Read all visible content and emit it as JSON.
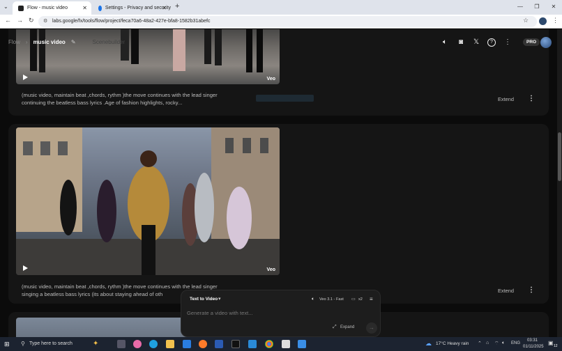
{
  "browser": {
    "tabs": [
      {
        "title": "Flow - music video",
        "icon": "flow-favicon",
        "active": true
      },
      {
        "title": "Settings - Privacy and security",
        "icon": "gear-favicon",
        "active": false
      }
    ],
    "url": "labs.google/fx/tools/flow/project/feca70a6-48a2-427e-bfa8-1582b31abefc"
  },
  "app": {
    "breadcrumb": {
      "root": "Flow",
      "current": "music video",
      "scenebuilder": "Scenebuilder"
    },
    "pro_badge": "PRO",
    "icons": [
      "speaker-icon",
      "discord-icon",
      "x-icon",
      "help-icon",
      "more-vert-icon"
    ]
  },
  "cards": [
    {
      "prompt": "(music video, maintain beat ,chords, rythm )the move continues with the lead singer continuing the beatless bass lyrics .Age of fashion highlights, rocky...",
      "badge": "Veo",
      "extend_label": "Extend"
    },
    {
      "prompt": "(music video, maintain beat ,chords, rythm )the move continues with the lead singer singing a beatless bass lyrics (its about staying ahead of oth",
      "badge": "Veo",
      "extend_label": "Extend"
    }
  ],
  "composer": {
    "mode": "Text to Video",
    "model": "Veo 3.1 - Fast",
    "count": "x2",
    "placeholder": "Generate a video with text...",
    "expand_label": "Expand"
  },
  "taskbar": {
    "search_placeholder": "Type here to search",
    "weather": "17°C  Heavy rain",
    "lang": "ENG",
    "time": "03:31",
    "date": "01/11/2025",
    "notifications": "12"
  },
  "colors": {
    "page_bg": "#0b0b0b",
    "card_bg": "#151515",
    "accent": "#4285f4"
  }
}
